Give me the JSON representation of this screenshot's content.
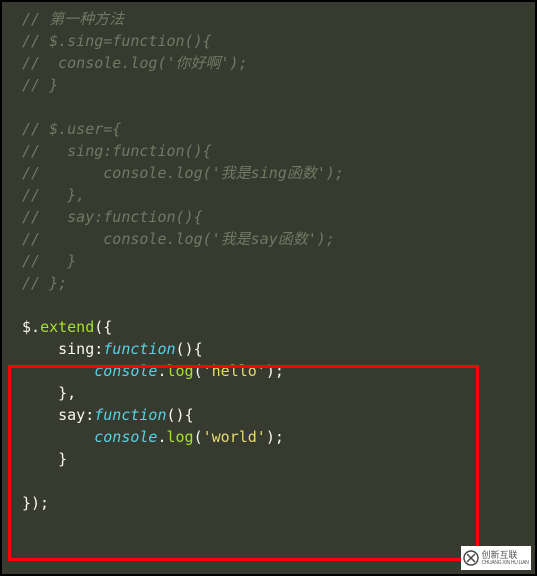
{
  "comments": {
    "c0": "// 第一种方法",
    "c1": "// $.sing=function(){",
    "c2": "//  console.log('你好啊');",
    "c3": "// }",
    "c4": "// $.user={",
    "c5": "//   sing:function(){",
    "c6": "//       console.log('我是sing函数');",
    "c7": "//   },",
    "c8": "//   say:function(){",
    "c9": "//       console.log('我是say函数');",
    "c10": "//   }",
    "c11": "// };"
  },
  "code": {
    "dollar": "$",
    "dot": ".",
    "extend": "extend",
    "openParenBrace": "({",
    "sing": "sing",
    "say": "say",
    "colon": ":",
    "function": "function",
    "paren": "()",
    "open": "{",
    "close": "}",
    "closeComma": "},",
    "closeAll": "});",
    "indent4": "    ",
    "indent8": "        ",
    "console": "console",
    "log": "log",
    "openParen": "(",
    "closeParen": ")",
    "semi": ";",
    "strHello": "'hello'",
    "strWorld": "'world'"
  },
  "logo": {
    "brand": "创新互联",
    "sub": "CHUANG XIN HU LIAN"
  }
}
